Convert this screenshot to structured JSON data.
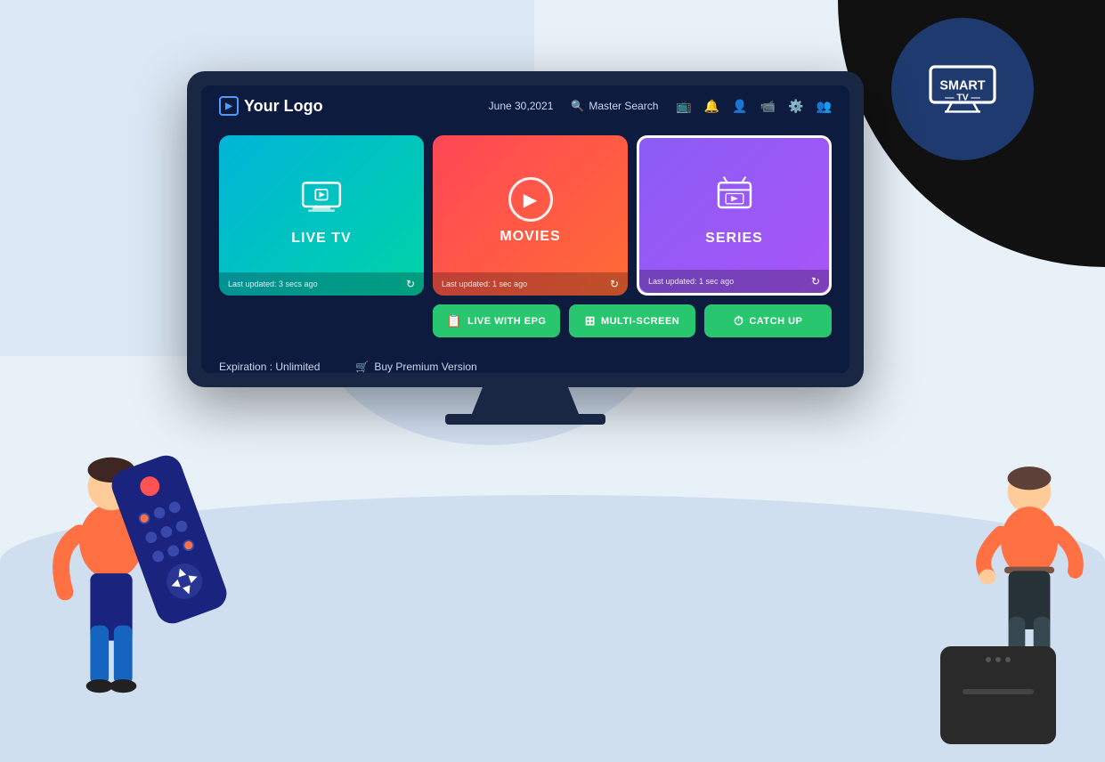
{
  "page": {
    "background_color": "#e8f0f8"
  },
  "smart_tv_badge": {
    "smart_label": "SMART",
    "tv_label": "TV",
    "dashes": "- -"
  },
  "tv_header": {
    "logo_text": "Your Logo",
    "date": "June 30,2021",
    "search_placeholder": "Master Search",
    "icons": [
      "tv-icon",
      "bell-icon",
      "user-icon",
      "camera-icon",
      "gear-icon",
      "users-icon"
    ]
  },
  "cards": {
    "live_tv": {
      "label": "LIVE TV",
      "update_text": "Last updated: 3 secs ago"
    },
    "movies": {
      "label": "MOVIES",
      "update_text": "Last updated: 1 sec ago"
    },
    "series": {
      "label": "SERIES",
      "update_text": "Last updated: 1 sec ago"
    }
  },
  "action_buttons": {
    "live_epg": "LIVE WITH EPG",
    "multi_screen": "MULTI-SCREEN",
    "catch_up": "CATCH UP"
  },
  "footer": {
    "expiration_label": "Expiration :",
    "expiration_value": "Unlimited",
    "buy_premium": "Buy Premium Version"
  }
}
